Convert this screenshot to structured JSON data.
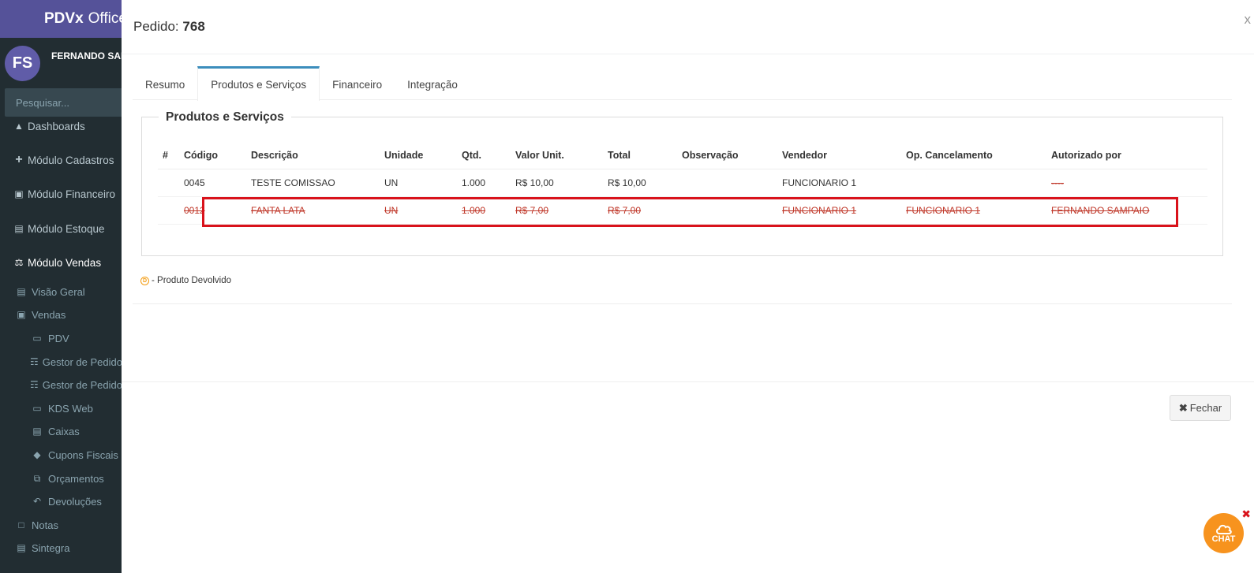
{
  "sidebar": {
    "brand_bold": "PDVx",
    "brand_rest": "Office",
    "avatar_initials": "FS",
    "user_name": "FERNANDO SAMPAIO",
    "search_placeholder": "Pesquisar...",
    "items": [
      {
        "label": "Dashboards",
        "icon": "area-chart-icon"
      },
      {
        "label": "Módulo Cadastros",
        "icon": "plus-icon"
      },
      {
        "label": "Módulo Financeiro",
        "icon": "money-icon"
      },
      {
        "label": "Módulo Estoque",
        "icon": "archive-icon"
      },
      {
        "label": "Módulo Vendas",
        "icon": "balance-scale-icon"
      },
      {
        "label": "Visão Geral",
        "icon": "bar-chart-icon"
      },
      {
        "label": "Vendas",
        "icon": "money-icon"
      },
      {
        "label": "PDV",
        "icon": "desktop-icon"
      },
      {
        "label": "Gestor de Pedidos",
        "icon": "sitemap-icon"
      },
      {
        "label": "Gestor de Pedidos",
        "icon": "sitemap-icon"
      },
      {
        "label": "KDS Web",
        "icon": "desktop-icon"
      },
      {
        "label": "Caixas",
        "icon": "fax-icon"
      },
      {
        "label": "Cupons Fiscais",
        "icon": "ticket-icon"
      },
      {
        "label": "Orçamentos",
        "icon": "copy-icon"
      },
      {
        "label": "Devoluções",
        "icon": "reply-icon"
      },
      {
        "label": "Notas",
        "icon": "file-icon"
      },
      {
        "label": "Sintegra",
        "icon": "file-text-icon"
      }
    ]
  },
  "modal": {
    "title_label": "Pedido:",
    "order_number": "768",
    "close_symbol": "x",
    "tabs": [
      "Resumo",
      "Produtos e Serviços",
      "Financeiro",
      "Integração"
    ],
    "active_tab": "Produtos e Serviços",
    "section_title": "Produtos e Serviços",
    "columns": [
      "#",
      "Código",
      "Descrição",
      "Unidade",
      "Qtd.",
      "Valor Unit.",
      "Total",
      "Observação",
      "Vendedor",
      "Op. Cancelamento",
      "Autorizado por"
    ],
    "rows": [
      {
        "num": "",
        "codigo": "0045",
        "descricao": "TESTE COMISSAO",
        "unidade": "UN",
        "qtd": "1.000",
        "valor_unit": "R$ 10,00",
        "total": "R$ 10,00",
        "observacao": "",
        "vendedor": "FUNCIONARIO 1",
        "op_cancelamento": "",
        "autorizado_por": "----"
      },
      {
        "num": "",
        "codigo": "0012",
        "descricao": "FANTA LATA",
        "unidade": "UN",
        "qtd": "1.000",
        "valor_unit": "R$ 7,00",
        "total": "R$ 7,00",
        "observacao": "",
        "vendedor": "FUNCIONARIO 1",
        "op_cancelamento": "FUNCIONARIO 1",
        "autorizado_por": "FERNANDO SAMPAIO"
      }
    ],
    "legend_badge": "D",
    "legend_text": "- Produto Devolvido",
    "close_button_label": "Fechar"
  },
  "chat_label": "CHAT",
  "colors": {
    "sidebar_bg": "#222d32",
    "brand_bg": "#555299",
    "avatar_bg": "#605ca8",
    "tab_accent": "#3c8dbc",
    "cancelled_text": "#c0392b",
    "highlight_frame": "#d9121b",
    "chat_orange": "#f7931e"
  }
}
